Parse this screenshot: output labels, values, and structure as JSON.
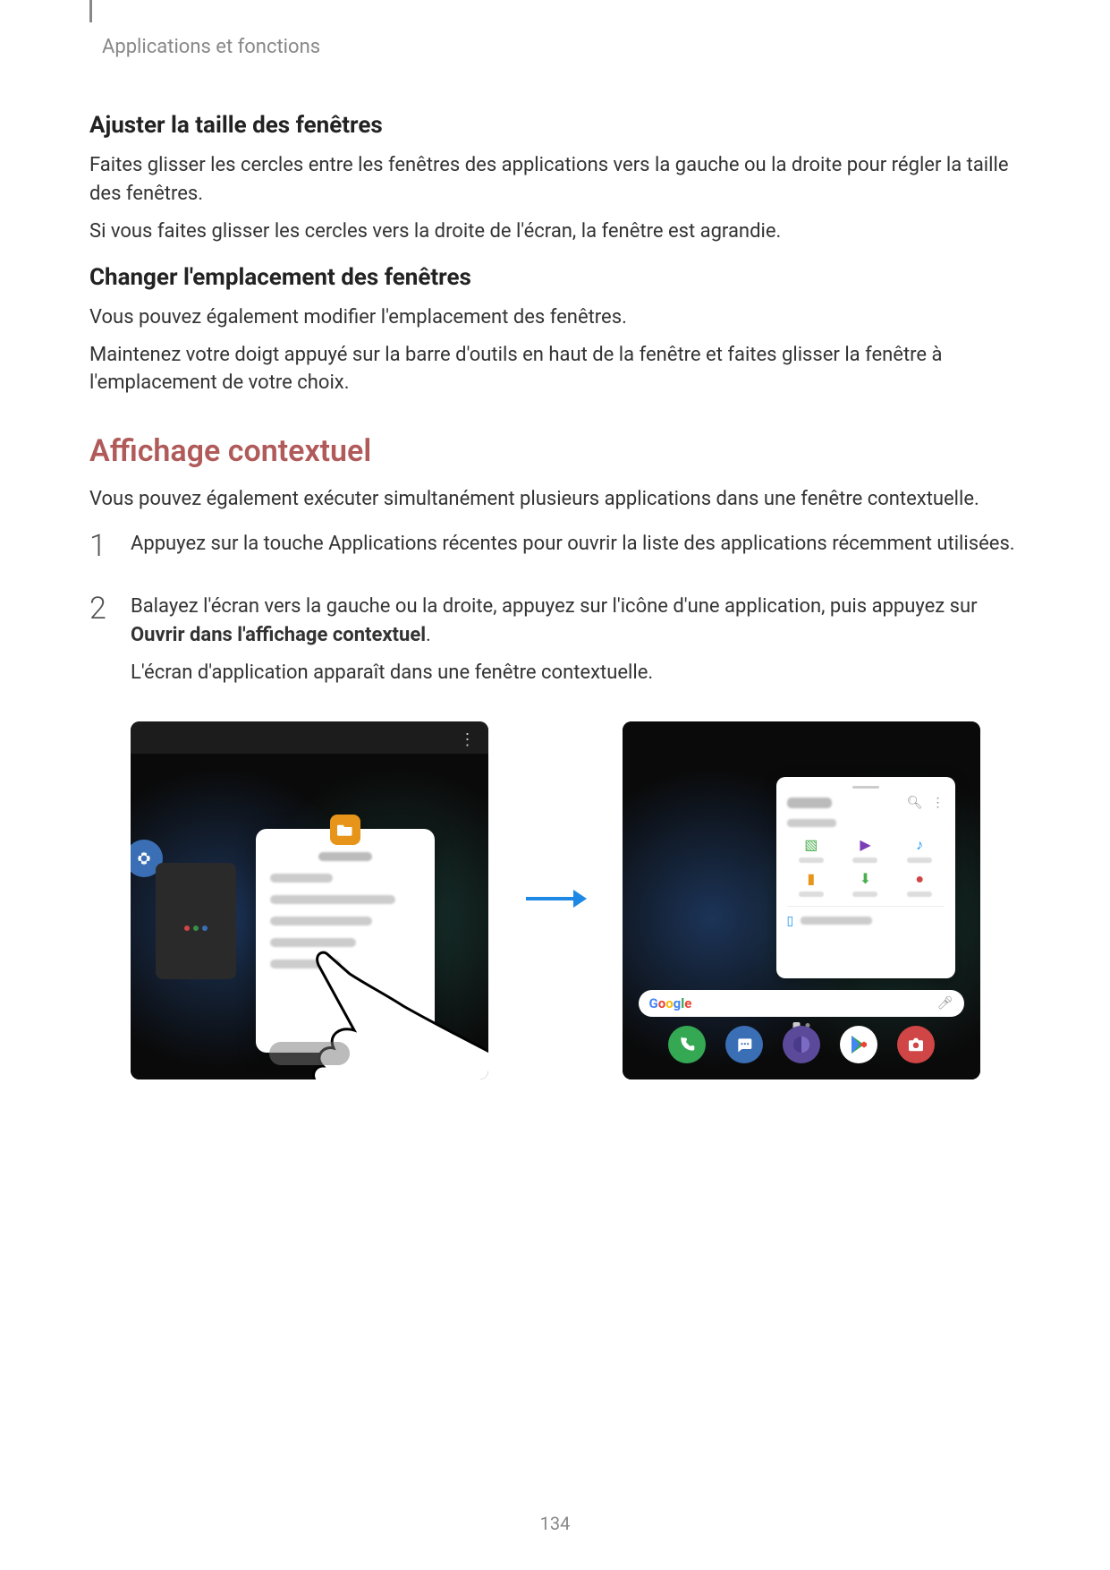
{
  "breadcrumb": "Applications et fonctions",
  "section1": {
    "heading": "Ajuster la taille des fenêtres",
    "p1": "Faites glisser les cercles entre les fenêtres des applications vers la gauche ou la droite pour régler la taille des fenêtres.",
    "p2": "Si vous faites glisser les cercles vers la droite de l'écran, la fenêtre est agrandie."
  },
  "section2": {
    "heading": "Changer l'emplacement des fenêtres",
    "p1": "Vous pouvez également modifier l'emplacement des fenêtres.",
    "p2": "Maintenez votre doigt appuyé sur la barre d'outils en haut de la fenêtre et faites glisser la fenêtre à l'emplacement de votre choix."
  },
  "section3": {
    "heading": "Affichage contextuel",
    "intro": "Vous pouvez également exécuter simultanément plusieurs applications dans une fenêtre contextuelle.",
    "step1": "Appuyez sur la touche Applications récentes pour ouvrir la liste des applications récemment utilisées.",
    "step2a": "Balayez l'écran vers la gauche ou la droite, appuyez sur l'icône d'une application, puis appuyez sur ",
    "step2b": "Ouvrir dans l'affichage contextuel",
    "step2c": ".",
    "step2d": "L'écran d'application apparaît dans une fenêtre contextuelle."
  },
  "page_number": "134"
}
